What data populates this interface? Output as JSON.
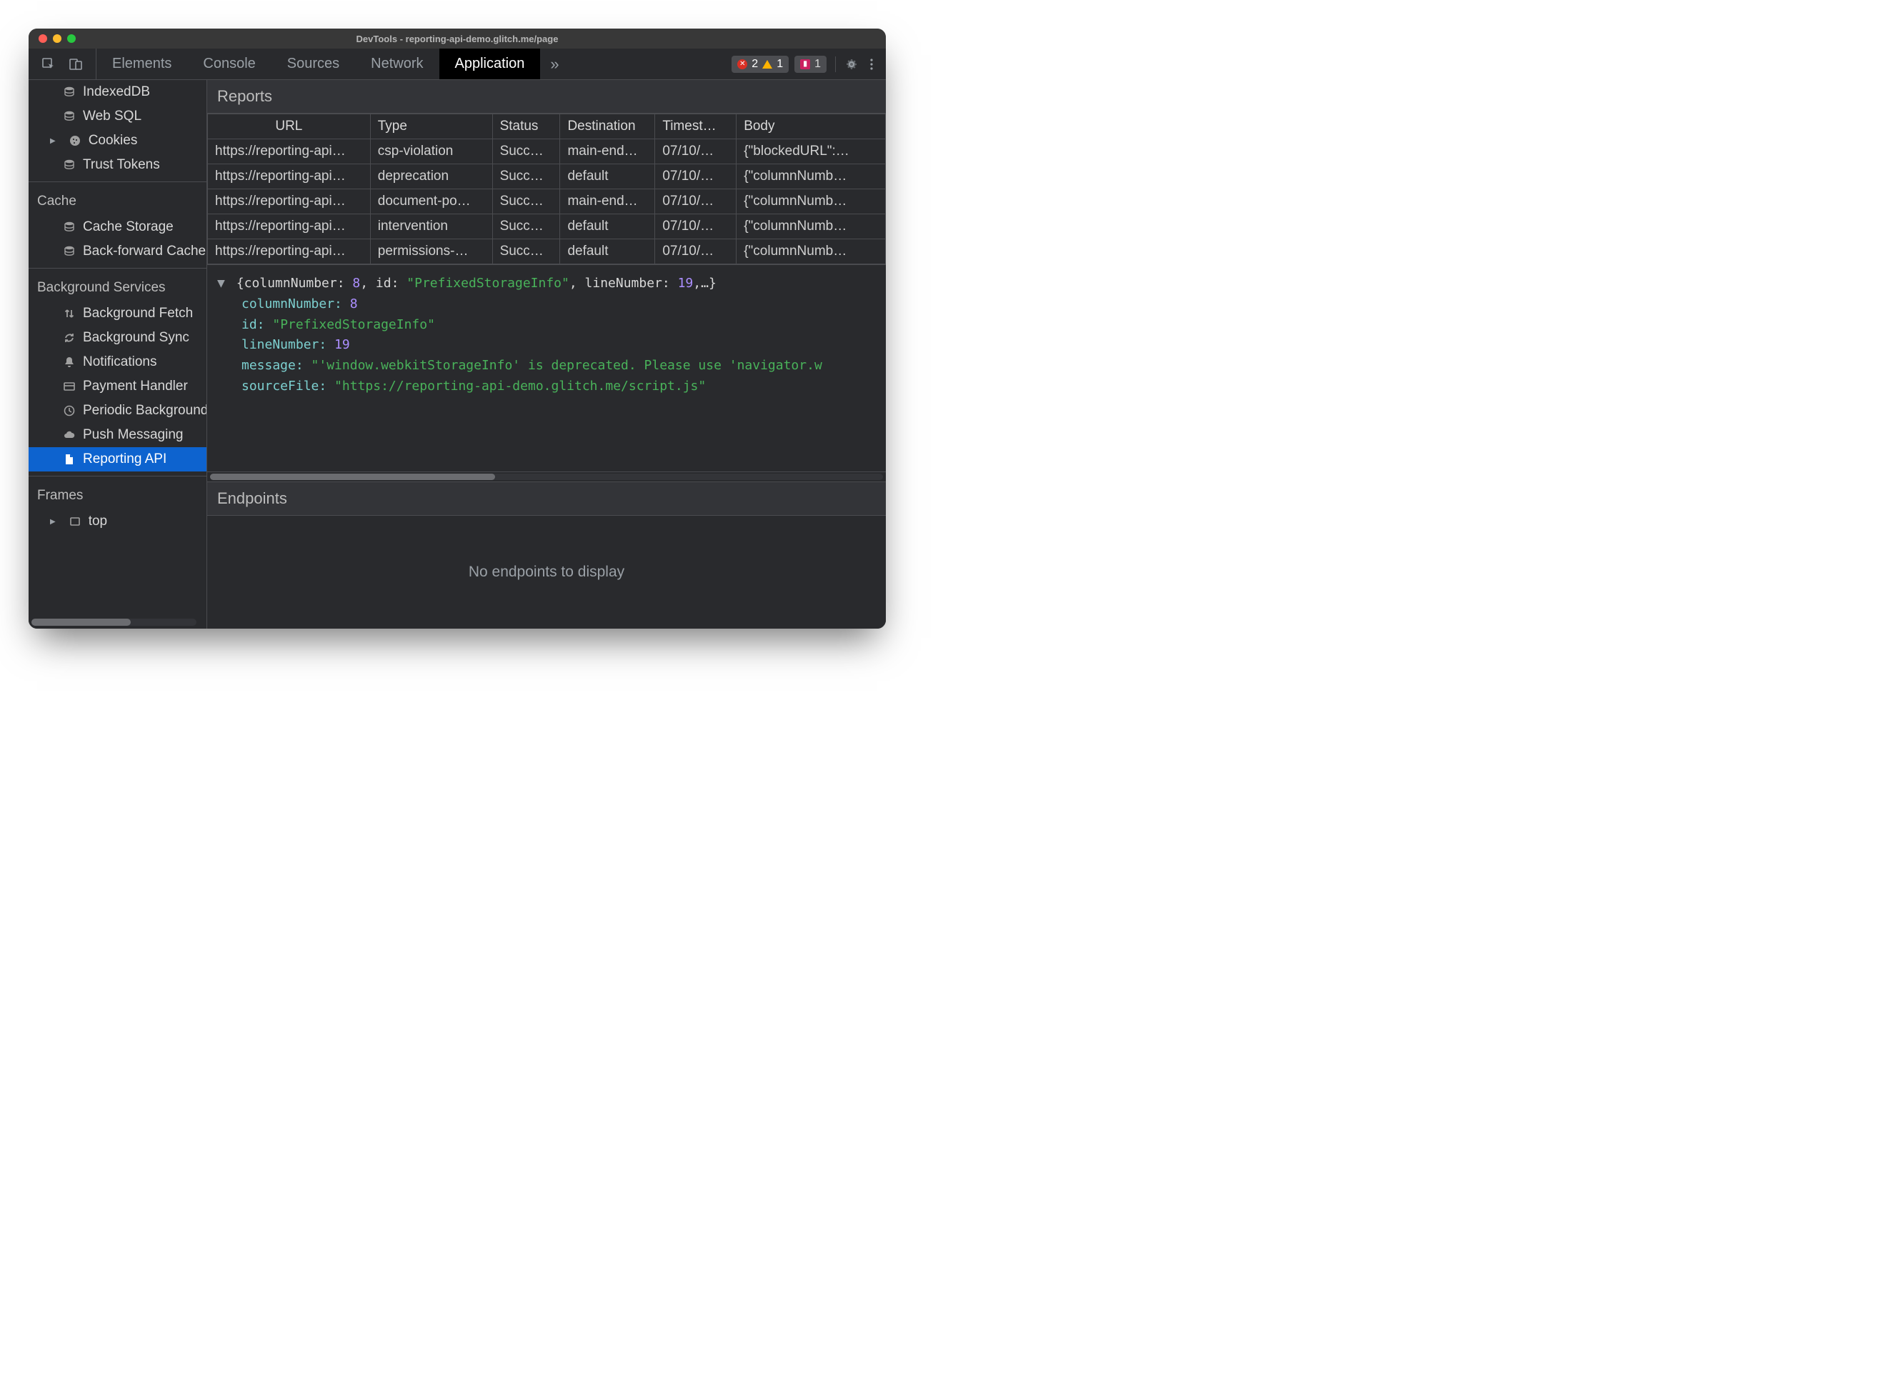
{
  "window_title": "DevTools - reporting-api-demo.glitch.me/page",
  "tabs": [
    "Elements",
    "Console",
    "Sources",
    "Network",
    "Application"
  ],
  "active_tab": "Application",
  "more_tabs_glyph": "»",
  "counters": {
    "errors": 2,
    "warnings": 1,
    "breakpoints": 1
  },
  "sidebar": {
    "storage_items": [
      {
        "icon": "db",
        "label": "IndexedDB"
      },
      {
        "icon": "db",
        "label": "Web SQL"
      },
      {
        "icon": "cookie",
        "label": "Cookies",
        "expandable": true
      },
      {
        "icon": "db",
        "label": "Trust Tokens"
      }
    ],
    "cache_heading": "Cache",
    "cache_items": [
      {
        "icon": "db",
        "label": "Cache Storage"
      },
      {
        "icon": "db",
        "label": "Back-forward Cache"
      }
    ],
    "bg_heading": "Background Services",
    "bg_items": [
      {
        "icon": "updown",
        "label": "Background Fetch"
      },
      {
        "icon": "sync",
        "label": "Background Sync"
      },
      {
        "icon": "bell",
        "label": "Notifications"
      },
      {
        "icon": "card",
        "label": "Payment Handler"
      },
      {
        "icon": "clock",
        "label": "Periodic Background Sync"
      },
      {
        "icon": "cloud",
        "label": "Push Messaging"
      },
      {
        "icon": "file",
        "label": "Reporting API",
        "selected": true
      }
    ],
    "frames_heading": "Frames",
    "frames_items": [
      {
        "icon": "frame",
        "label": "top",
        "expandable": true
      }
    ]
  },
  "reports": {
    "title": "Reports",
    "columns": [
      "URL",
      "Type",
      "Status",
      "Destination",
      "Timest…",
      "Body"
    ],
    "rows": [
      {
        "url": "https://reporting-api…",
        "type": "csp-violation",
        "status": "Succ…",
        "destination": "main-end…",
        "timestamp": "07/10/…",
        "body": "{\"blockedURL\":…"
      },
      {
        "url": "https://reporting-api…",
        "type": "deprecation",
        "status": "Succ…",
        "destination": "default",
        "timestamp": "07/10/…",
        "body": "{\"columnNumb…"
      },
      {
        "url": "https://reporting-api…",
        "type": "document-po…",
        "status": "Succ…",
        "destination": "main-end…",
        "timestamp": "07/10/…",
        "body": "{\"columnNumb…"
      },
      {
        "url": "https://reporting-api…",
        "type": "intervention",
        "status": "Succ…",
        "destination": "default",
        "timestamp": "07/10/…",
        "body": "{\"columnNumb…"
      },
      {
        "url": "https://reporting-api…",
        "type": "permissions-…",
        "status": "Succ…",
        "destination": "default",
        "timestamp": "07/10/…",
        "body": "{\"columnNumb…"
      }
    ]
  },
  "detail": {
    "summary_prefix": "{columnNumber: ",
    "summary_num": "8",
    "summary_mid": ", id: ",
    "summary_str": "\"PrefixedStorageInfo\"",
    "summary_mid2": ", lineNumber: ",
    "summary_num2": "19",
    "summary_suffix": ",…}",
    "columnNumber_key": "columnNumber:",
    "columnNumber_val": "8",
    "id_key": "id:",
    "id_val": "\"PrefixedStorageInfo\"",
    "lineNumber_key": "lineNumber:",
    "lineNumber_val": "19",
    "message_key": "message:",
    "message_val": "\"'window.webkitStorageInfo' is deprecated. Please use 'navigator.w",
    "sourceFile_key": "sourceFile:",
    "sourceFile_val": "\"https://reporting-api-demo.glitch.me/script.js\""
  },
  "endpoints": {
    "title": "Endpoints",
    "empty": "No endpoints to display"
  }
}
